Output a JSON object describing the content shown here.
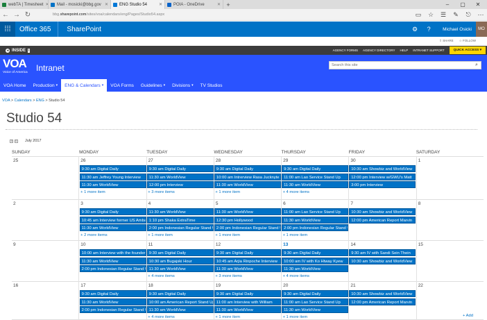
{
  "browser": {
    "tabs": [
      {
        "label": "webTA | Timesheet",
        "color": "#1a7f3c"
      },
      {
        "label": "Mail - mosicki@bbg.gov",
        "color": "#0072c6"
      },
      {
        "label": "ENG Studio 54",
        "color": "#0078d7"
      },
      {
        "label": "POIA - OneDrive",
        "color": "#0a63c9"
      }
    ],
    "new_tab": "+",
    "url_prefix": "bbg.",
    "url_host": "sharepoint.com",
    "url_path": "/sites/voa/calendars/eng/Pages/Studio54.aspx"
  },
  "suite": {
    "product": "Office 365",
    "app": "SharePoint",
    "user": "Michael Osicki",
    "avatar": "MO"
  },
  "actions": {
    "share": "SHARE",
    "follow": "FOLLOW"
  },
  "insidebar": {
    "label": "INSIDE",
    "badge": "i",
    "links": [
      "AGENCY FORMS",
      "AGENCY DIRECTORY",
      "HELP",
      "INTRANET SUPPORT"
    ],
    "quick_access": "QUICK ACCESS"
  },
  "brand": {
    "logo": "VOA",
    "logo_sub": "Voice of America",
    "site": "Intranet",
    "search_placeholder": "Search this site"
  },
  "nav": [
    {
      "label": "VOA Home",
      "dropdown": false
    },
    {
      "label": "Production",
      "dropdown": true
    },
    {
      "label": "ENG & Calendars",
      "dropdown": true,
      "selected": true
    },
    {
      "label": "VOA Forms",
      "dropdown": false
    },
    {
      "label": "Guidelines",
      "dropdown": true
    },
    {
      "label": "Divisions",
      "dropdown": true
    },
    {
      "label": "TV Studios",
      "dropdown": false
    }
  ],
  "breadcrumb": [
    "VOA",
    "Calendars",
    "ENG",
    "Studio 54"
  ],
  "page_title": "Studio 54",
  "calendar": {
    "month": "July 2017",
    "add_link": "+ Add",
    "weekdays": [
      "SUNDAY",
      "MONDAY",
      "TUESDAY",
      "WEDNESDAY",
      "THURSDAY",
      "FRIDAY",
      "SATURDAY"
    ],
    "weeks": [
      {
        "days": [
          "25",
          "26",
          "27",
          "28",
          "29",
          "30",
          "1"
        ],
        "today_index": -1,
        "events": [
          {
            "col": 1,
            "row": 0,
            "text": "9:30 am Digital Daily"
          },
          {
            "col": 1,
            "row": 1,
            "text": "11:30 am Jeffrey Young Interview"
          },
          {
            "col": 1,
            "row": 2,
            "text": "11:30 am WorldView"
          },
          {
            "col": 2,
            "row": 0,
            "text": "9:30 am Digital Daily"
          },
          {
            "col": 2,
            "row": 1,
            "text": "11:30 am WorldView"
          },
          {
            "col": 2,
            "row": 2,
            "text": "12:00 pm Interview"
          },
          {
            "col": 3,
            "row": 0,
            "text": "9:30 am Digital Daily"
          },
          {
            "col": 3,
            "row": 1,
            "text": "10:00 am Intrerview Rasa Jucknyte"
          },
          {
            "col": 3,
            "row": 2,
            "text": "11:30 am WorldView"
          },
          {
            "col": 4,
            "row": 0,
            "text": "9:30 am Digital Daily"
          },
          {
            "col": 4,
            "row": 1,
            "text": "11:00 am Lao Service Stand Up"
          },
          {
            "col": 4,
            "row": 2,
            "text": "11:30 am WorldView"
          },
          {
            "col": 5,
            "row": 0,
            "text": "10:30 am Showbiz and WorldView"
          },
          {
            "col": 5,
            "row": 1,
            "text": "12:00 pm Interview w/GWU's Matt"
          },
          {
            "col": 5,
            "row": 2,
            "text": "3:00 pm Interview"
          }
        ],
        "more": [
          {
            "col": 1,
            "text": "+ 1 more item"
          },
          {
            "col": 2,
            "text": "+ 3 more items"
          },
          {
            "col": 3,
            "text": "+ 1 more item"
          },
          {
            "col": 4,
            "text": "+ 4 more items"
          }
        ]
      },
      {
        "days": [
          "2",
          "3",
          "4",
          "5",
          "6",
          "7",
          "8"
        ],
        "today_index": -1,
        "events": [
          {
            "col": 1,
            "row": 0,
            "text": "9:30 am Digital Daily"
          },
          {
            "col": 1,
            "row": 1,
            "text": "10:45 am Interview former US Ambassador"
          },
          {
            "col": 1,
            "row": 2,
            "text": "11:30 am WorldView"
          },
          {
            "col": 2,
            "row": 0,
            "text": "11:30 am WorldView"
          },
          {
            "col": 2,
            "row": 1,
            "text": "1:10 pm Shaka ExtraTime"
          },
          {
            "col": 2,
            "row": 2,
            "text": "2:00 pm Indonesian Regular Stand Up"
          },
          {
            "col": 3,
            "row": 0,
            "text": "11:30 am WorldView"
          },
          {
            "col": 3,
            "row": 1,
            "text": "12:30 pm Hollywood"
          },
          {
            "col": 3,
            "row": 2,
            "text": "2:00 pm Indonesian Regular Stand Up"
          },
          {
            "col": 4,
            "row": 0,
            "text": "11:00 am Lao Service Stand Up"
          },
          {
            "col": 4,
            "row": 1,
            "text": "11:30 am WorldView"
          },
          {
            "col": 4,
            "row": 2,
            "text": "2:00 pm Indonesian Regular Stand Up"
          },
          {
            "col": 5,
            "row": 0,
            "text": "10:30 am Showbiz and WorldView"
          },
          {
            "col": 5,
            "row": 1,
            "text": "12:00 pm American Report Marvin"
          }
        ],
        "more": [
          {
            "col": 1,
            "text": "+ 2 more items"
          },
          {
            "col": 2,
            "text": "+ 1 more item"
          },
          {
            "col": 3,
            "text": "+ 1 more item"
          },
          {
            "col": 4,
            "text": "+ 1 more item"
          }
        ]
      },
      {
        "days": [
          "9",
          "10",
          "11",
          "12",
          "13",
          "14",
          "15"
        ],
        "today_index": 4,
        "events": [
          {
            "col": 1,
            "row": 0,
            "text": "10:00 am Interview with the founder"
          },
          {
            "col": 1,
            "row": 1,
            "text": "11:30 am WorldView"
          },
          {
            "col": 1,
            "row": 2,
            "text": "2:00 pm Indonesian Regular Stand Up"
          },
          {
            "col": 2,
            "row": 0,
            "text": "9:30 am Digital Daily"
          },
          {
            "col": 2,
            "row": 1,
            "text": "10:30 am Bugajski Hour"
          },
          {
            "col": 2,
            "row": 2,
            "text": "11:30 am WorldView"
          },
          {
            "col": 3,
            "row": 0,
            "text": "9:30 am Digital Daily"
          },
          {
            "col": 3,
            "row": 1,
            "text": "10:45 am Arjia Rinpoche Interview"
          },
          {
            "col": 3,
            "row": 2,
            "text": "11:30 am WorldView"
          },
          {
            "col": 4,
            "row": 0,
            "text": "9:30 am Digital Daily"
          },
          {
            "col": 4,
            "row": 1,
            "text": "10:00 am IV with Ko Htway Kyew"
          },
          {
            "col": 4,
            "row": 2,
            "text": "11:30 am WorldView"
          },
          {
            "col": 5,
            "row": 0,
            "text": "9:30 am IV with Sandi Sein Thein"
          },
          {
            "col": 5,
            "row": 1,
            "text": "10:30 am Showbiz and WorldView"
          }
        ],
        "more": [
          {
            "col": 2,
            "text": "+ 4 more items"
          },
          {
            "col": 3,
            "text": "+ 3 more items"
          },
          {
            "col": 4,
            "text": "+ 4 more items"
          }
        ]
      },
      {
        "days": [
          "16",
          "17",
          "18",
          "19",
          "20",
          "21",
          "22"
        ],
        "today_index": -1,
        "events": [
          {
            "col": 1,
            "row": 0,
            "text": "9:30 am Digital Daily"
          },
          {
            "col": 1,
            "row": 1,
            "text": "11:30 am WorldView"
          },
          {
            "col": 1,
            "row": 2,
            "text": "2:00 pm Indonesian Regular Stand Up"
          },
          {
            "col": 2,
            "row": 0,
            "text": "9:30 am Digital Daily"
          },
          {
            "col": 2,
            "row": 1,
            "text": "10:00 am American Report Stand Up"
          },
          {
            "col": 2,
            "row": 2,
            "text": "11:30 am WorldView"
          },
          {
            "col": 3,
            "row": 0,
            "text": "9:30 am Digital Daily"
          },
          {
            "col": 3,
            "row": 1,
            "text": "11:00 am Interview with William"
          },
          {
            "col": 3,
            "row": 2,
            "text": "11:30 am WorldView"
          },
          {
            "col": 4,
            "row": 0,
            "text": "9:30 am Digital Daily"
          },
          {
            "col": 4,
            "row": 1,
            "text": "11:00 am Lao Service Stand Up"
          },
          {
            "col": 4,
            "row": 2,
            "text": "11:30 am WorldView"
          },
          {
            "col": 5,
            "row": 0,
            "text": "10:30 am Showbiz and WorldView"
          },
          {
            "col": 5,
            "row": 1,
            "text": "12:00 pm American Report Marvin"
          }
        ],
        "more": [
          {
            "col": 2,
            "text": "+ 4 more items"
          },
          {
            "col": 3,
            "text": "+ 1 more item"
          },
          {
            "col": 4,
            "text": "+ 1 more item"
          }
        ]
      }
    ]
  }
}
